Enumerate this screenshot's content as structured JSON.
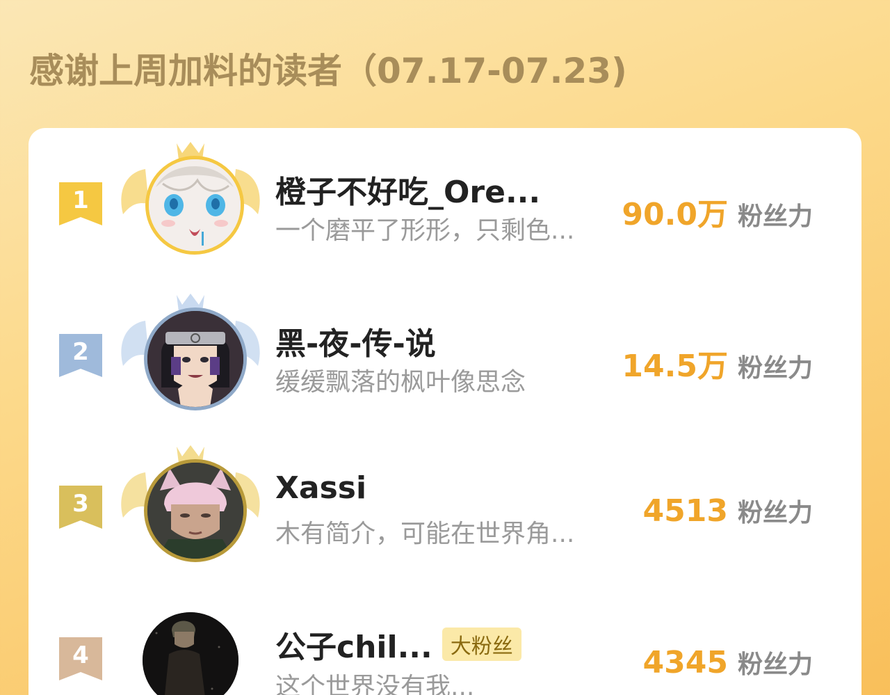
{
  "header": {
    "title": "感谢上周加料的读者（07.17-07.23)"
  },
  "readers": [
    {
      "rank": "1",
      "name": "橙子不好吃_Ore...",
      "bio": "一个磨平了形形，只剩色...",
      "score": "90.0万",
      "score_unit": "粉丝力",
      "avatar_icon": "anime-girl-avatar",
      "rank_color": "#f5c842",
      "wing_color": "#f7d77a",
      "ring_color": "#f5c842"
    },
    {
      "rank": "2",
      "name": "黑-夜-传-说",
      "bio": "缓缓飘落的枫叶像思念",
      "score": "14.5万",
      "score_unit": "粉丝力",
      "avatar_icon": "ninja-avatar",
      "rank_color": "#9fbadb",
      "wing_color": "#c9daf0",
      "ring_color": "#8fa9c8"
    },
    {
      "rank": "3",
      "name": "Xassi",
      "bio": "木有简介，可能在世界角...",
      "score": "4513",
      "score_unit": "粉丝力",
      "avatar_icon": "pink-hair-avatar",
      "rank_color": "#d9bf5c",
      "wing_color": "#f3dc8e",
      "ring_color": "#b89a3a"
    },
    {
      "rank": "4",
      "name": "公子chil...",
      "tag": "大粉丝",
      "bio": "这个世界没有我...",
      "score": "4345",
      "score_unit": "粉丝力",
      "avatar_icon": "dark-silhouette-avatar",
      "rank_color": "#d8b89a",
      "wing_color": "",
      "ring_color": ""
    }
  ]
}
